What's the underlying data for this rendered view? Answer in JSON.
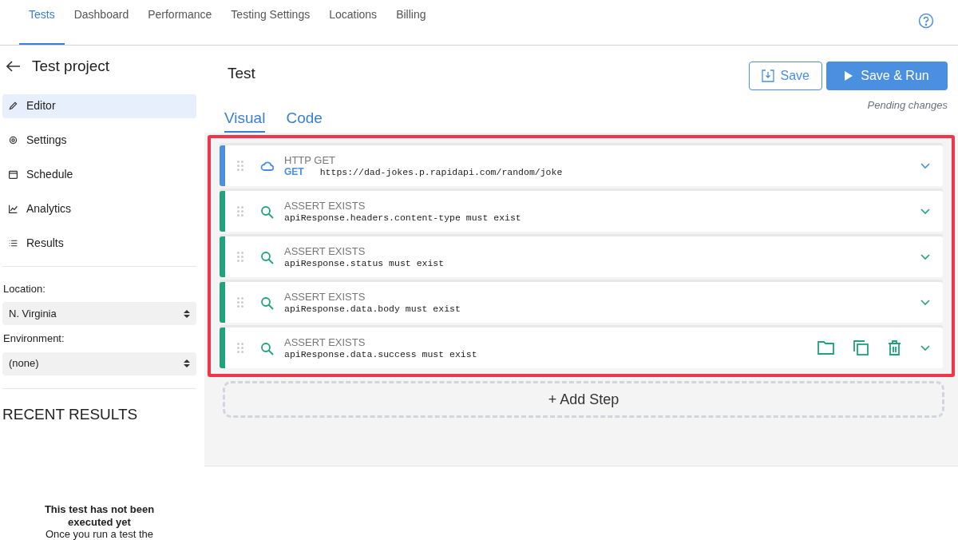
{
  "nav": {
    "tabs": [
      {
        "label": "Tests",
        "selected": true
      },
      {
        "label": "Dashboard",
        "selected": false
      },
      {
        "label": "Performance",
        "selected": false
      },
      {
        "label": "Testing Settings",
        "selected": false
      },
      {
        "label": "Locations",
        "selected": false
      },
      {
        "label": "Billing",
        "selected": false
      }
    ]
  },
  "sidebar": {
    "title": "Test project",
    "items": [
      {
        "label": "Editor",
        "selected": true
      },
      {
        "label": "Settings",
        "selected": false
      },
      {
        "label": "Schedule",
        "selected": false
      },
      {
        "label": "Analytics",
        "selected": false
      },
      {
        "label": "Results",
        "selected": false
      }
    ],
    "location": {
      "label": "Location:",
      "value": "N. Virginia"
    },
    "environment": {
      "label": "Environment:",
      "value": "(none)"
    },
    "recent_results": {
      "heading": "RECENT RESULTS",
      "empty_title": "This test has not been executed yet",
      "empty_text": "Once you run a test the"
    }
  },
  "editor": {
    "title": "Test",
    "save": "Save",
    "save_run": "Save & Run",
    "status": "Pending changes",
    "tabs": [
      {
        "label": "Visual",
        "selected": true
      },
      {
        "label": "Code",
        "selected": false
      }
    ],
    "steps": [
      {
        "kind": "http",
        "title": "HTTP GET",
        "method": "GET",
        "detail": "https://dad-jokes.p.rapidapi.com/random/joke",
        "actions_visible": false
      },
      {
        "kind": "assert",
        "title": "ASSERT EXISTS",
        "detail": "apiResponse.headers.content-type must exist",
        "actions_visible": false
      },
      {
        "kind": "assert",
        "title": "ASSERT EXISTS",
        "detail": "apiResponse.status must exist",
        "actions_visible": false
      },
      {
        "kind": "assert",
        "title": "ASSERT EXISTS",
        "detail": "apiResponse.data.body must exist",
        "actions_visible": false
      },
      {
        "kind": "assert",
        "title": "ASSERT EXISTS",
        "detail": "apiResponse.data.success must exist",
        "actions_visible": true
      }
    ],
    "add_step": "+ Add Step"
  }
}
